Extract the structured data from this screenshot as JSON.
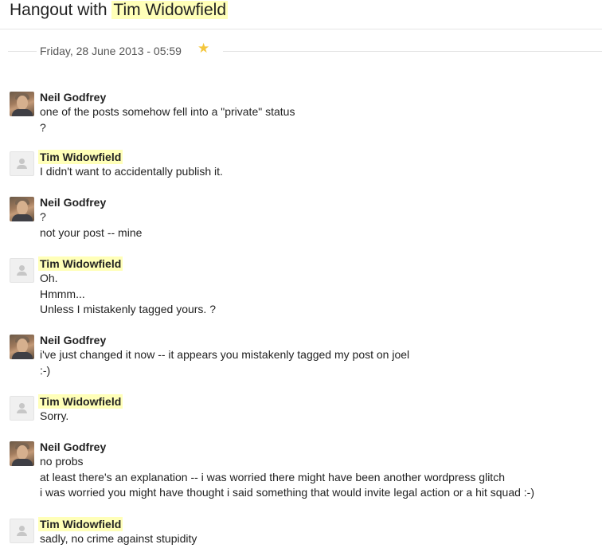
{
  "header": {
    "title_prefix": "Hangout with ",
    "title_name": "Tim Widowfield"
  },
  "date_separator": {
    "label": "Friday, 28 June 2013 - 05:59",
    "star_icon": "star-icon"
  },
  "colors": {
    "highlight": "#ffffb8",
    "star": "#f4c63c"
  },
  "messages": [
    {
      "sender": "Neil Godfrey",
      "lines": [
        "one of the posts somehow fell into a \"private\" status",
        "?"
      ]
    },
    {
      "sender": "Tim Widowfield",
      "lines": [
        "I didn't want to accidentally publish it."
      ]
    },
    {
      "sender": "Neil Godfrey",
      "lines": [
        "?",
        "not your post -- mine"
      ]
    },
    {
      "sender": "Tim Widowfield",
      "lines": [
        "Oh.",
        "Hmmm...",
        "Unless I mistakenly tagged yours. ?"
      ]
    },
    {
      "sender": "Neil Godfrey",
      "lines": [
        "i've just changed it now -- it appears you mistakenly tagged my post on joel",
        ":-)"
      ]
    },
    {
      "sender": "Tim Widowfield",
      "lines": [
        "Sorry."
      ]
    },
    {
      "sender": "Neil Godfrey",
      "lines": [
        "no probs",
        "at least there's an explanation -- i was worried there might have been another wordpress glitch",
        "i was worried you might have thought i said something that would invite legal action or a hit squad :-)"
      ]
    },
    {
      "sender": "Tim Widowfield",
      "lines": [
        "sadly, no crime against stupidity"
      ]
    }
  ]
}
